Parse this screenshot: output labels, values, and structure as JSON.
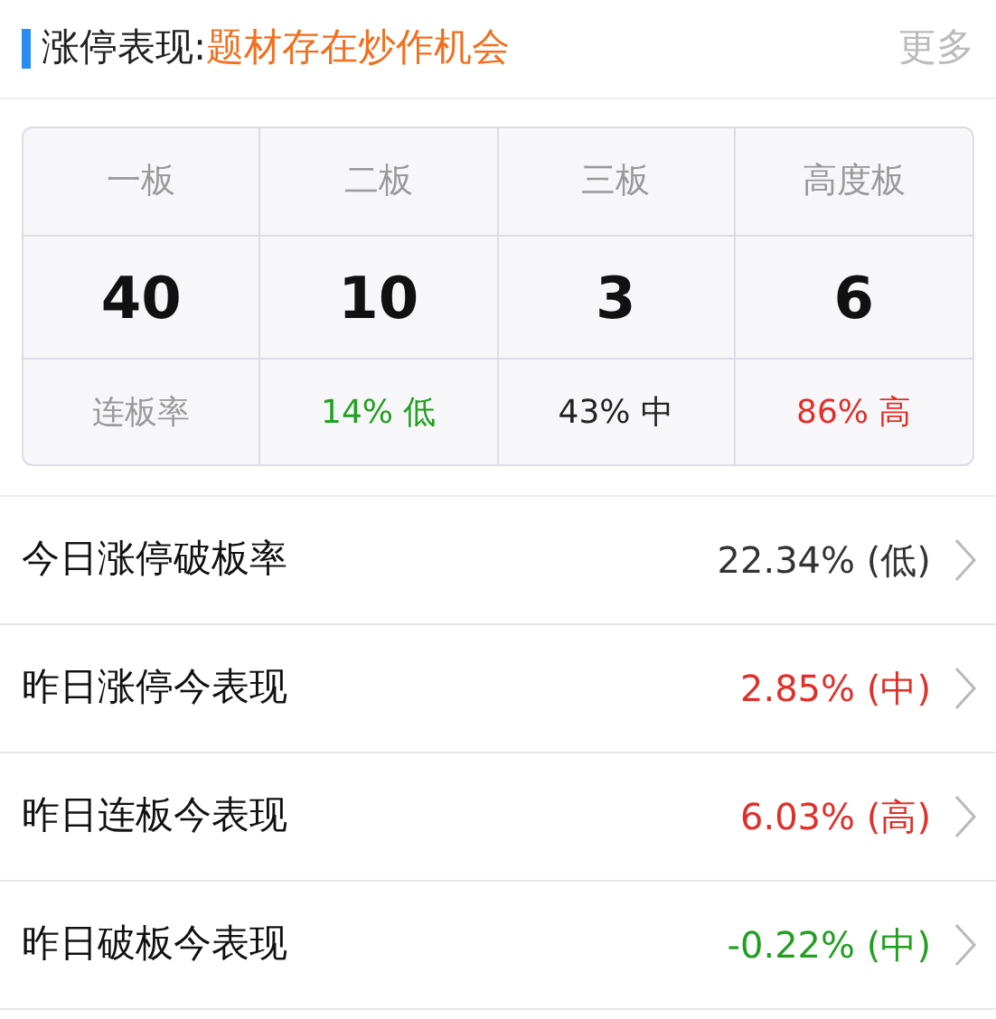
{
  "header": {
    "label": "涨停表现:",
    "highlight": "题材存在炒作机会",
    "more": "更多"
  },
  "board_table": {
    "columns": [
      "一板",
      "二板",
      "三板",
      "高度板"
    ],
    "counts": [
      "40",
      "10",
      "3",
      "6"
    ],
    "rates": [
      {
        "text": "连板率",
        "color": "#999999"
      },
      {
        "text": "14% 低",
        "color": "#22a022"
      },
      {
        "text": "43% 中",
        "color": "#222222"
      },
      {
        "text": "86% 高",
        "color": "#e0302a"
      }
    ]
  },
  "rows": [
    {
      "label": "今日涨停破板率",
      "value": "22.34% (低)",
      "color": "#333333"
    },
    {
      "label": "昨日涨停今表现",
      "value": "2.85% (中)",
      "color": "#e0302a"
    },
    {
      "label": "昨日连板今表现",
      "value": "6.03% (高)",
      "color": "#e0302a"
    },
    {
      "label": "昨日破板今表现",
      "value": "-0.22% (中)",
      "color": "#22a022"
    }
  ]
}
